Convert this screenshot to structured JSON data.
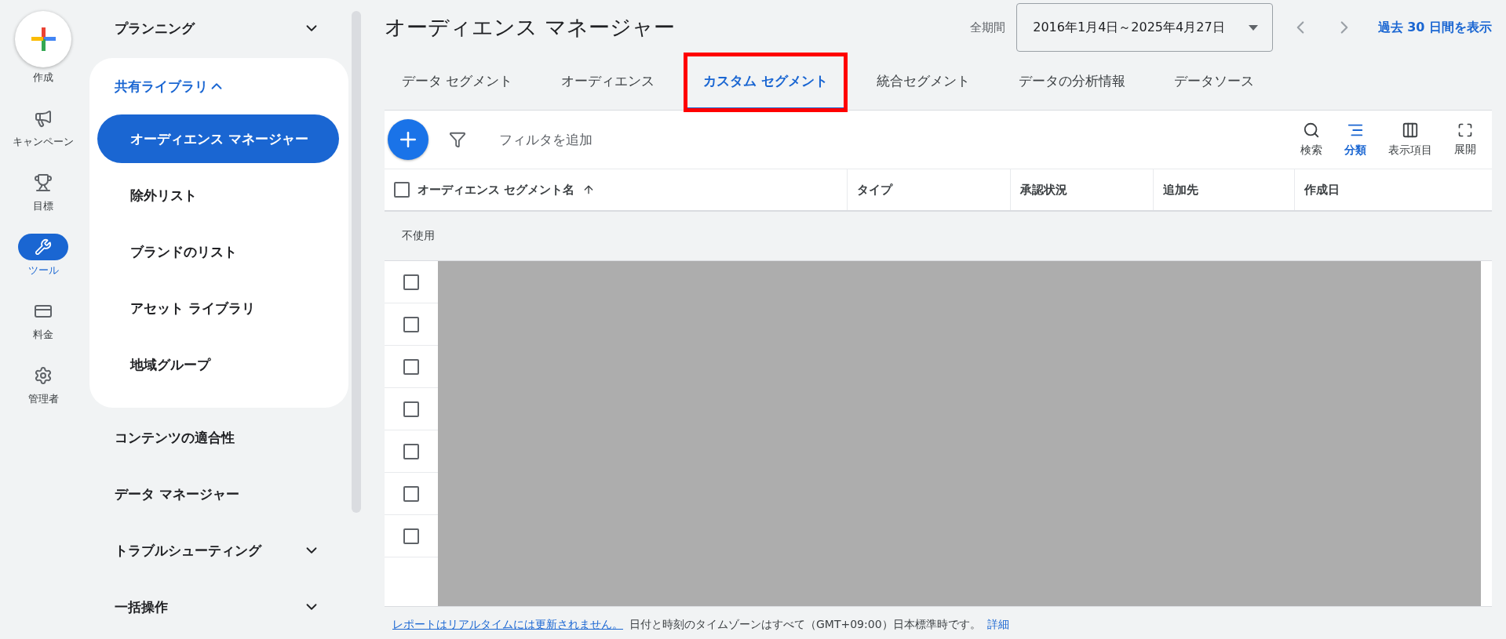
{
  "rail": [
    {
      "kind": "create",
      "label": "作成",
      "selected": false
    },
    {
      "kind": "campaign",
      "label": "キャンペーン",
      "selected": false
    },
    {
      "kind": "goal",
      "label": "目標",
      "selected": false
    },
    {
      "kind": "tools",
      "label": "ツール",
      "selected": true
    },
    {
      "kind": "billing",
      "label": "料金",
      "selected": false
    },
    {
      "kind": "admin",
      "label": "管理者",
      "selected": false
    }
  ],
  "nav": [
    {
      "label": "プランニング",
      "expandable": true,
      "expanded": false
    },
    {
      "label": "共有ライブラリ",
      "expandable": true,
      "expanded": true,
      "children": [
        {
          "label": "オーディエンス マネージャー",
          "selected": true
        },
        {
          "label": "除外リスト",
          "selected": false
        },
        {
          "label": "ブランドのリスト",
          "selected": false
        },
        {
          "label": "アセット ライブラリ",
          "selected": false
        },
        {
          "label": "地域グループ",
          "selected": false
        }
      ]
    },
    {
      "label": "コンテンツの適合性",
      "expandable": false,
      "expanded": false
    },
    {
      "label": "データ マネージャー",
      "expandable": false,
      "expanded": false
    },
    {
      "label": "トラブルシューティング",
      "expandable": true,
      "expanded": false
    },
    {
      "label": "一括操作",
      "expandable": true,
      "expanded": false
    }
  ],
  "page": {
    "title": "オーディエンス マネージャー",
    "period_label": "全期間",
    "date_range": "2016年1月4日～2025年4月27日",
    "recent_link": "過去 30 日間を表示"
  },
  "tabs": [
    {
      "label": "データ セグメント",
      "selected": false,
      "highlighted": false
    },
    {
      "label": "オーディエンス",
      "selected": false,
      "highlighted": false
    },
    {
      "label": "カスタム セグメント",
      "selected": true,
      "highlighted": true
    },
    {
      "label": "統合セグメント",
      "selected": false,
      "highlighted": false
    },
    {
      "label": "データの分析情報",
      "selected": false,
      "highlighted": false
    },
    {
      "label": "データソース",
      "selected": false,
      "highlighted": false
    }
  ],
  "toolbar": {
    "filter_placeholder": "フィルタを追加",
    "actions": [
      {
        "kind": "search",
        "label": "検索",
        "selected": false
      },
      {
        "kind": "segment",
        "label": "分類",
        "selected": true
      },
      {
        "kind": "columns",
        "label": "表示項目",
        "selected": false
      },
      {
        "kind": "expand",
        "label": "展開",
        "selected": false
      }
    ]
  },
  "table": {
    "select_all_checked": false,
    "columns": [
      "オーディエンス セグメント名",
      "タイプ",
      "承認状況",
      "追加先",
      "作成日"
    ],
    "group_label": "不使用",
    "rows": [
      {
        "checked": false
      },
      {
        "checked": false
      },
      {
        "checked": false
      },
      {
        "checked": false
      },
      {
        "checked": false
      },
      {
        "checked": false
      },
      {
        "checked": false
      }
    ]
  },
  "footer": {
    "link": "レポートはリアルタイムには更新されません。",
    "text": "日付と時刻のタイムゾーンはすべて（GMT+09:00）日本標準時です。",
    "details": "詳細"
  }
}
